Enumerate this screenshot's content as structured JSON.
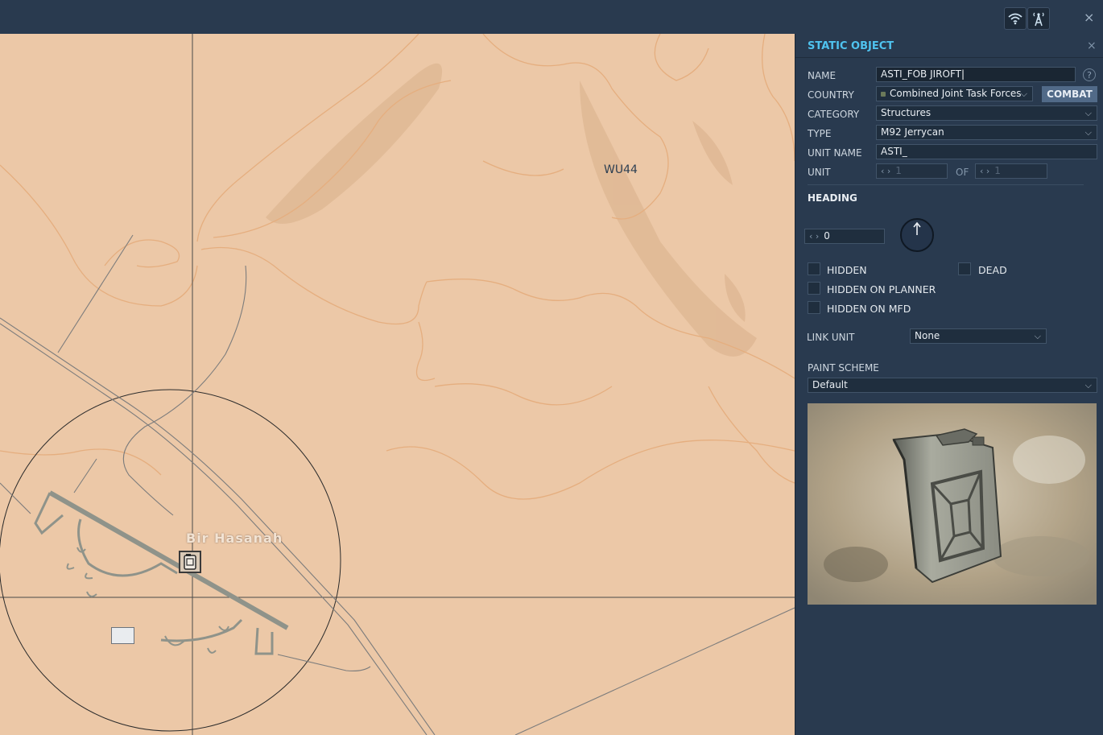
{
  "window": {
    "close_glyph": "×"
  },
  "toolbar": {
    "icons": [
      "wifi-icon",
      "antenna-tower-icon"
    ]
  },
  "map": {
    "grid_label": "WU44",
    "airbase_label": "Bir Hasanah",
    "colors": {
      "terrain": "#ecc8a7",
      "contour": "#e5ae7f",
      "road": "#7c7c7c",
      "grid": "#4a4a4a"
    }
  },
  "panel": {
    "title": "STATIC OBJECT",
    "close_glyph": "×",
    "name_label": "NAME",
    "name_value": "ASTI_FOB JIROFT",
    "help_glyph": "?",
    "country_label": "COUNTRY",
    "country_value": "Combined Joint Task Forces",
    "combat_button": "COMBAT",
    "category_label": "CATEGORY",
    "category_value": "Structures",
    "type_label": "TYPE",
    "type_value": "M92 Jerrycan",
    "unit_name_label": "UNIT NAME",
    "unit_name_value": "ASTI_",
    "unit_label": "UNIT",
    "unit_value": "1",
    "of_label": "OF",
    "of_value": "1",
    "heading_title": "HEADING",
    "heading_value": "0",
    "hidden_label": "HIDDEN",
    "dead_label": "DEAD",
    "hidden_on_planner_label": "HIDDEN ON PLANNER",
    "hidden_on_mfd_label": "HIDDEN ON MFD",
    "link_unit_label": "LINK UNIT",
    "link_unit_value": "None",
    "paint_scheme_label": "PAINT SCHEME",
    "paint_scheme_value": "Default",
    "accent_color": "#4fc3ef"
  }
}
